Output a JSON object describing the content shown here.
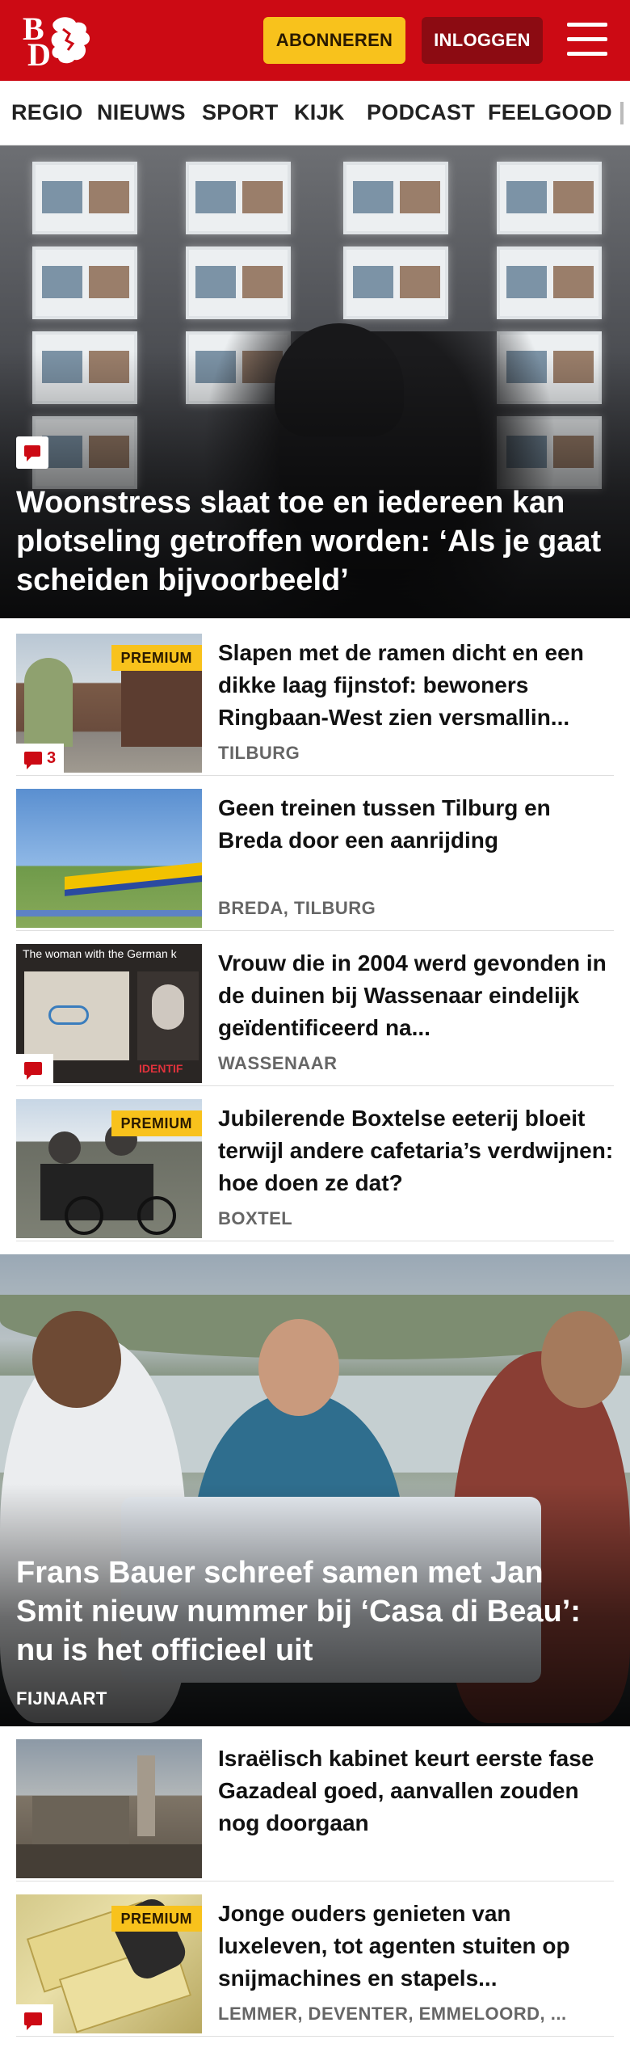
{
  "header": {
    "logo_text": "BD",
    "subscribe_label": "ABONNEREN",
    "login_label": "INLOGGEN",
    "menu_icon": "hamburger-menu-icon",
    "colors": {
      "brand_red": "#cc0a14",
      "subscribe_yellow": "#f8c21c",
      "login_dark_red": "#8c0b12"
    }
  },
  "nav": {
    "items": [
      "REGIO",
      "NIEUWS",
      "SPORT",
      "KIJK",
      "PODCAST",
      "FEELGOOD"
    ]
  },
  "hero1": {
    "title": "Woonstress slaat toe en iedereen kan plotseling getroffen worden: ‘Als je gaat scheiden bijvoorbeeld’",
    "comment_icon": "comment-icon"
  },
  "articles": [
    {
      "title": "Slapen met de ramen dicht en een dikke laag fijnstof: bewoners Ringbaan-West zien versmallin...",
      "location": "TILBURG",
      "premium": "PREMIUM",
      "comments": "3"
    },
    {
      "title": "Geen treinen tussen Tilburg en Breda door een aanrijding",
      "location": "BREDA, TILBURG"
    },
    {
      "title": "Vrouw die in 2004 werd gevonden in de duinen bij Wassenaar eindelijk geïdentificeerd na...",
      "location": "WASSENAAR",
      "thumb_text": "The woman with the German k",
      "thumb_text2": "IDENTIF"
    },
    {
      "title": "Jubilerende Boxtelse eeterij bloeit terwijl andere cafetaria’s verdwijnen: hoe doen ze dat?",
      "location": "BOXTEL",
      "premium": "PREMIUM"
    }
  ],
  "hero2": {
    "title": "Frans Bauer schreef samen met Jan Smit nieuw nummer bij ‘Casa di Beau’: nu is het officieel uit",
    "location": "FIJNAART"
  },
  "articles2": [
    {
      "title": "Israëlisch kabinet keurt eerste fase Gazadeal goed, aanvallen zouden nog doorgaan",
      "location": ""
    },
    {
      "title": "Jonge ouders genieten van luxeleven, tot agenten stuiten op snijmachines en stapels...",
      "location": "LEMMER, DEVENTER, EMMELOORD, ...",
      "premium": "PREMIUM"
    }
  ]
}
